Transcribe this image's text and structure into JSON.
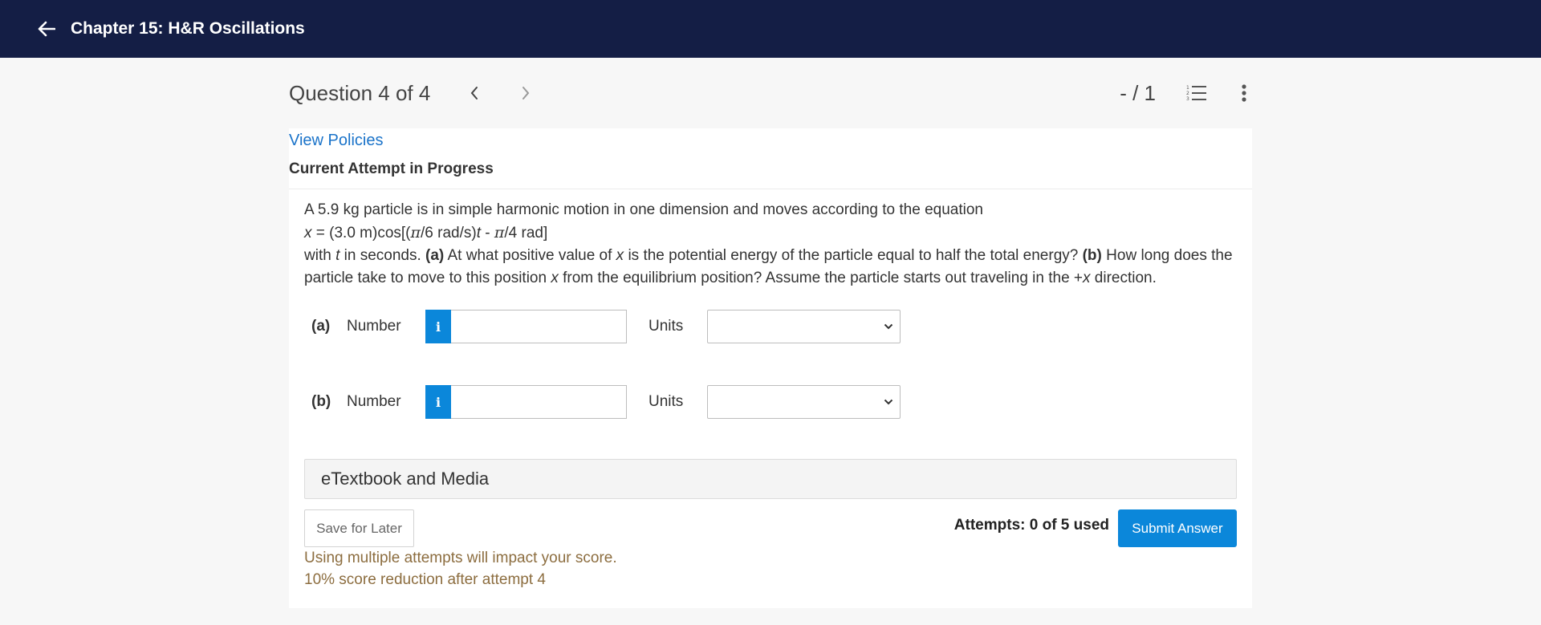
{
  "header": {
    "title": "Chapter 15: H&R Oscillations",
    "background": "#141e45"
  },
  "question_bar": {
    "title": "Question 4 of 4",
    "score": "- / 1",
    "icons": [
      "chevron-left-icon",
      "chevron-right-icon",
      "numbered-list-icon",
      "more-vertical-icon"
    ]
  },
  "card": {
    "view_policies": "View Policies",
    "attempt_heading": "Current Attempt in Progress"
  },
  "problem": {
    "line1": "A 5.9 kg particle is in simple harmonic motion in one dimension and moves according to the equation",
    "eq_x": "x",
    "eq_mid": " = (3.0 m)cos[(",
    "eq_pi1": "π",
    "eq_mid2": "/6 rad/s)",
    "eq_t": "t",
    "eq_mid3": " - ",
    "eq_pi2": "π",
    "eq_end": "/4 rad]",
    "l3_with": "with ",
    "l3_t": "t",
    "l3_a": " in seconds. ",
    "l3_a_label": "(a)",
    "l3_b": " At what positive value of ",
    "l3_x": "x",
    "l3_c": " is the potential energy of the particle equal to half the total energy? ",
    "l3_b_label": "(b)",
    "l3_d": " How long does the particle take to move to this position ",
    "l3_x2": "x",
    "l3_e": " from the equilibrium position? Assume the particle starts out traveling in the +",
    "l3_x3": "x",
    "l3_f": " direction."
  },
  "answers": [
    {
      "part": "(a)",
      "number_label": "Number",
      "info": "i",
      "value": "",
      "units_label": "Units",
      "units_selected": ""
    },
    {
      "part": "(b)",
      "number_label": "Number",
      "info": "i",
      "value": "",
      "units_label": "Units",
      "units_selected": ""
    }
  ],
  "media": {
    "label": "eTextbook and Media"
  },
  "footer": {
    "save_label": "Save for Later",
    "attempts_text": "Attempts: 0 of 5 used",
    "submit_label": "Submit Answer",
    "warning1": "Using multiple attempts will impact your score.",
    "warning2": "10% score reduction after attempt 4"
  },
  "colors": {
    "accent": "#0b87da",
    "link": "#1a73c9",
    "warning": "#8c6d3f"
  }
}
